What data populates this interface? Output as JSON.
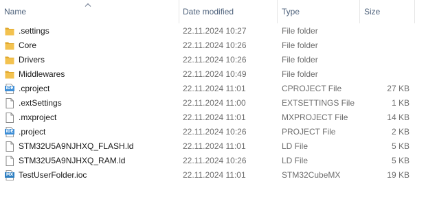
{
  "columns": {
    "name": "Name",
    "date_modified": "Date modified",
    "type": "Type",
    "size": "Size",
    "sort_icon": "chevron-up-icon"
  },
  "colors": {
    "folder": "#f3c24f",
    "folder_dark": "#e0a82e",
    "ide_badge": "#3e8ed6",
    "mx_badge": "#2f7fc1",
    "header_text": "#4c607a",
    "meta_text": "#6d6d6d"
  },
  "files": [
    {
      "name": ".settings",
      "date": "22.11.2024 10:27",
      "type": "File folder",
      "size": "",
      "icon": "folder-icon"
    },
    {
      "name": "Core",
      "date": "22.11.2024 10:26",
      "type": "File folder",
      "size": "",
      "icon": "folder-icon"
    },
    {
      "name": "Drivers",
      "date": "22.11.2024 10:26",
      "type": "File folder",
      "size": "",
      "icon": "folder-icon"
    },
    {
      "name": "Middlewares",
      "date": "22.11.2024 10:49",
      "type": "File folder",
      "size": "",
      "icon": "folder-icon"
    },
    {
      "name": ".cproject",
      "date": "22.11.2024 11:01",
      "type": "CPROJECT File",
      "size": "27 KB",
      "icon": "ide-file-icon",
      "badge": "IDE"
    },
    {
      "name": ".extSettings",
      "date": "22.11.2024 11:00",
      "type": "EXTSETTINGS File",
      "size": "1 KB",
      "icon": "blank-file-icon"
    },
    {
      "name": ".mxproject",
      "date": "22.11.2024 11:01",
      "type": "MXPROJECT File",
      "size": "14 KB",
      "icon": "blank-file-icon"
    },
    {
      "name": ".project",
      "date": "22.11.2024 10:26",
      "type": "PROJECT File",
      "size": "2 KB",
      "icon": "ide-file-icon",
      "badge": "IDE"
    },
    {
      "name": "STM32U5A9NJHXQ_FLASH.ld",
      "date": "22.11.2024 11:01",
      "type": "LD File",
      "size": "5 KB",
      "icon": "blank-file-icon"
    },
    {
      "name": "STM32U5A9NJHXQ_RAM.ld",
      "date": "22.11.2024 10:26",
      "type": "LD File",
      "size": "5 KB",
      "icon": "blank-file-icon"
    },
    {
      "name": "TestUserFolder.ioc",
      "date": "22.11.2024 11:01",
      "type": "STM32CubeMX",
      "size": "19 KB",
      "icon": "mx-file-icon",
      "badge": "MX"
    }
  ]
}
